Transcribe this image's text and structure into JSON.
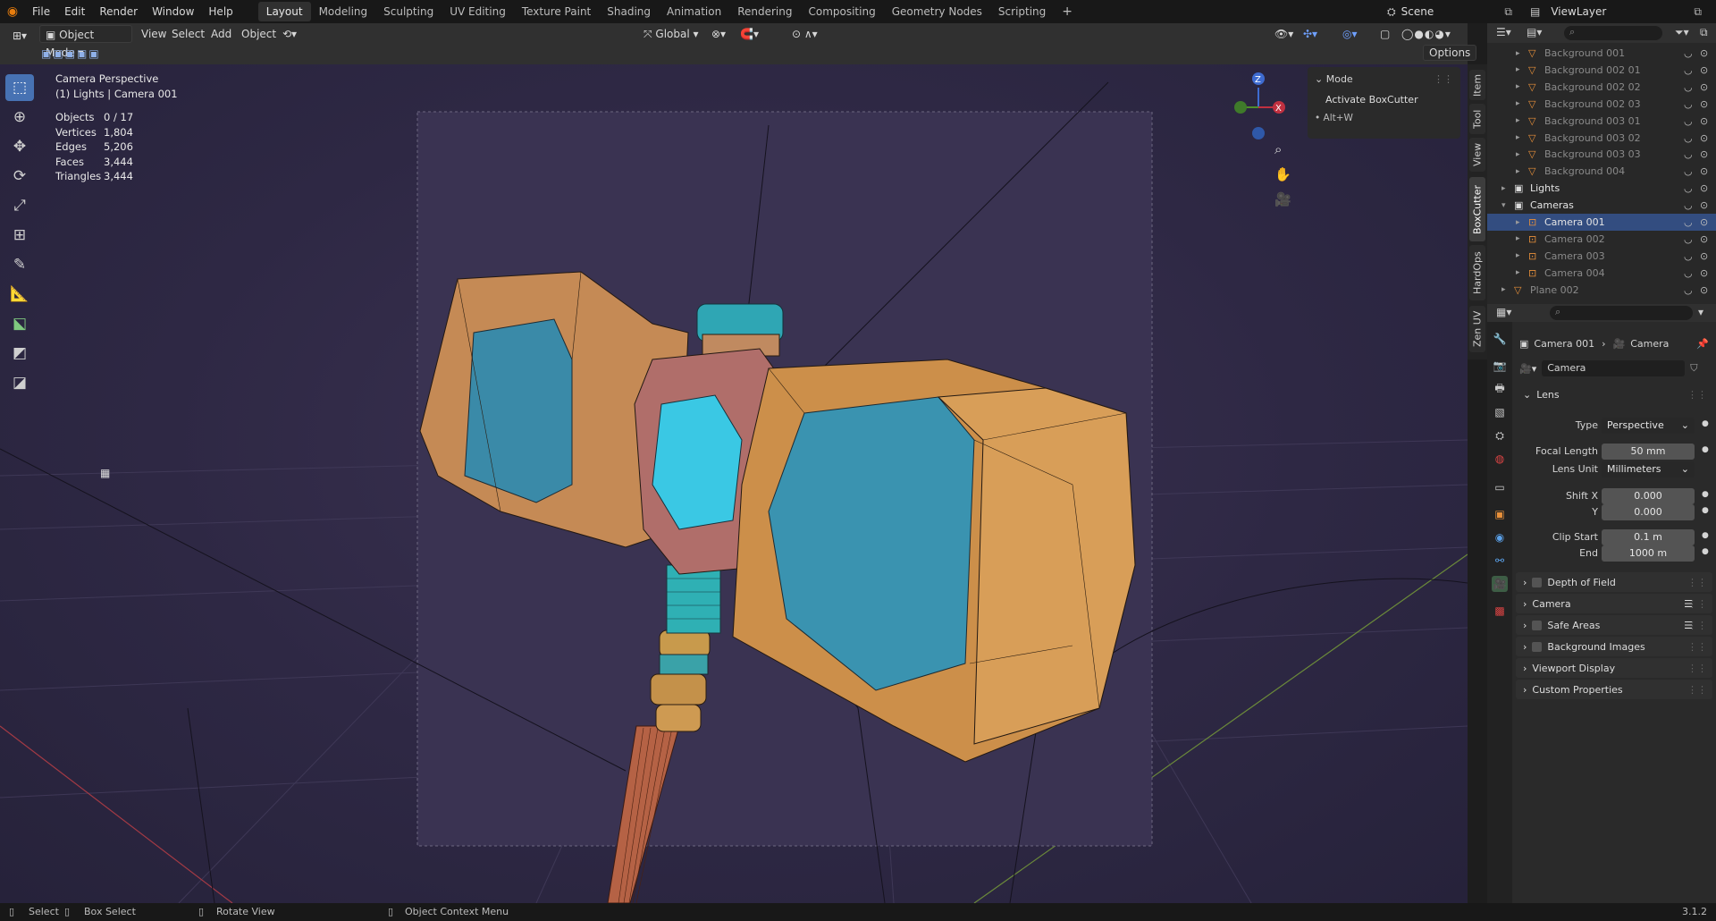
{
  "topbar": {
    "menus": [
      "File",
      "Edit",
      "Render",
      "Window",
      "Help"
    ],
    "workspaces": [
      "Layout",
      "Modeling",
      "Sculpting",
      "UV Editing",
      "Texture Paint",
      "Shading",
      "Animation",
      "Rendering",
      "Compositing",
      "Geometry Nodes",
      "Scripting"
    ],
    "active_workspace": "Layout",
    "add_tab": "+",
    "scene": "Scene",
    "view_layer": "ViewLayer"
  },
  "header": {
    "mode": "Object Mode",
    "menus": [
      "View",
      "Select",
      "Add",
      "Object"
    ],
    "orientation": "Global",
    "options": "Options"
  },
  "viewport": {
    "view_name": "Camera Perspective",
    "collection": "(1) Lights | Camera 001",
    "stats": [
      {
        "k": "Objects",
        "v": "0 / 17"
      },
      {
        "k": "Vertices",
        "v": "1,804"
      },
      {
        "k": "Edges",
        "v": "5,206"
      },
      {
        "k": "Faces",
        "v": "3,444"
      },
      {
        "k": "Triangles",
        "v": "3,444"
      }
    ],
    "gizmo": {
      "z": "Z",
      "x": "X"
    }
  },
  "mode_panel": {
    "title": "Mode",
    "item": "Activate BoxCutter",
    "shortcut": "• Alt+W"
  },
  "side_tabs": [
    "Item",
    "Tool",
    "View",
    "BoxCutter",
    "HardOps",
    "Zen UV"
  ],
  "outliner": {
    "rows": [
      {
        "name": "Background 001",
        "indent": 2,
        "dim": true
      },
      {
        "name": "Background 002 01",
        "indent": 2,
        "dim": true
      },
      {
        "name": "Background 002 02",
        "indent": 2,
        "dim": true
      },
      {
        "name": "Background 002 03",
        "indent": 2,
        "dim": true
      },
      {
        "name": "Background 003 01",
        "indent": 2,
        "dim": true
      },
      {
        "name": "Background 003 02",
        "indent": 2,
        "dim": true
      },
      {
        "name": "Background 003 03",
        "indent": 2,
        "dim": true
      },
      {
        "name": "Background 004",
        "indent": 2,
        "dim": true
      },
      {
        "name": "Lights",
        "indent": 1,
        "dim": false
      },
      {
        "name": "Cameras",
        "indent": 1,
        "dim": false
      },
      {
        "name": "Camera 001",
        "indent": 2,
        "dim": false,
        "selected": true
      },
      {
        "name": "Camera 002",
        "indent": 2,
        "dim": true
      },
      {
        "name": "Camera 003",
        "indent": 2,
        "dim": true
      },
      {
        "name": "Camera 004",
        "indent": 2,
        "dim": true
      },
      {
        "name": "Plane 002",
        "indent": 1,
        "dim": true
      }
    ]
  },
  "properties": {
    "breadcrumb_object": "Camera 001",
    "breadcrumb_data": "Camera",
    "datablock": "Camera",
    "lens": {
      "title": "Lens",
      "type_label": "Type",
      "type": "Perspective",
      "focal_label": "Focal Length",
      "focal": "50 mm",
      "unit_label": "Lens Unit",
      "unit": "Millimeters",
      "shiftx_label": "Shift X",
      "shiftx": "0.000",
      "shifty_label": "Y",
      "shifty": "0.000",
      "clipstart_label": "Clip Start",
      "clipstart": "0.1 m",
      "clipend_label": "End",
      "clipend": "1000 m"
    },
    "sections": [
      "Depth of Field",
      "Camera",
      "Safe Areas",
      "Background Images",
      "Viewport Display",
      "Custom Properties"
    ]
  },
  "status": {
    "select": "Select",
    "box_select": "Box Select",
    "rotate": "Rotate View",
    "context": "Object Context Menu",
    "version": "3.1.2"
  }
}
